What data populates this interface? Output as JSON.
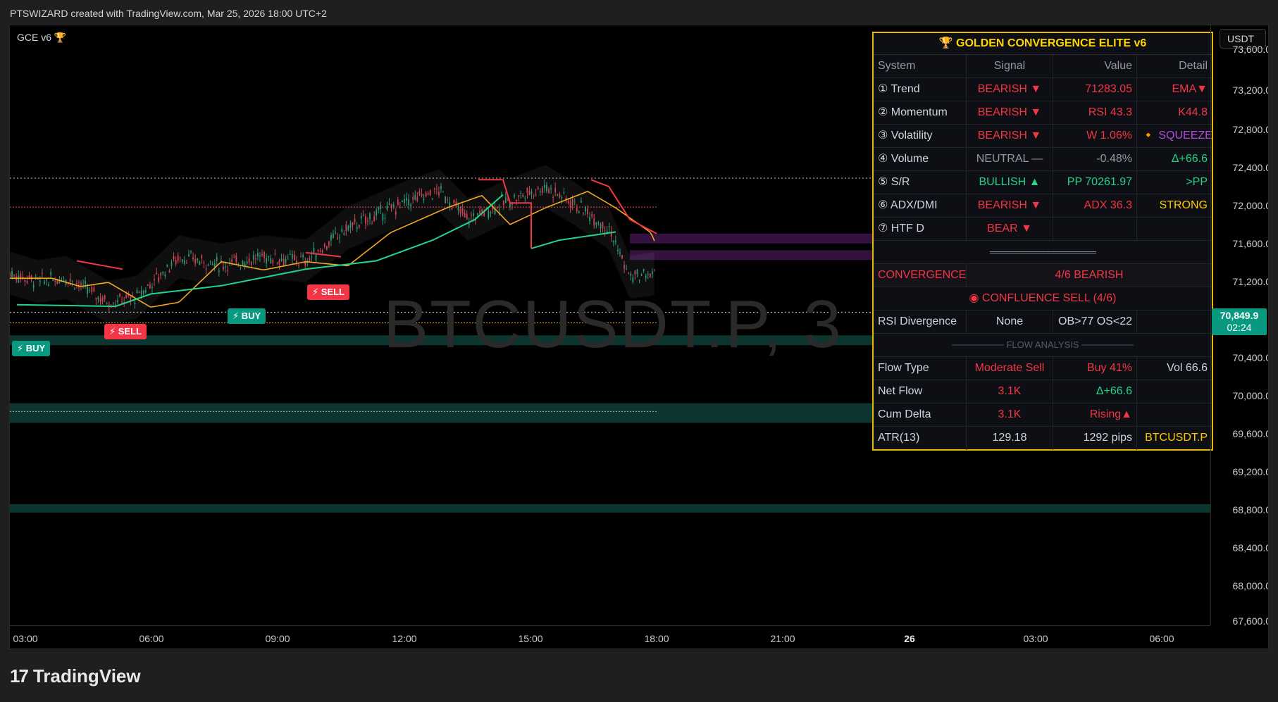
{
  "header": {
    "attribution": "PTSWIZARD created with TradingView.com, Mar 25, 2026 18:00 UTC+2"
  },
  "chart": {
    "indicator_label": "GCE v6 🏆",
    "watermark": "BTCUSDT.P, 3",
    "currency": "USDT",
    "last_price": "70,849.9",
    "countdown": "02:24",
    "price_ticks": [
      "73,600.0",
      "73,200.0",
      "72,800.0",
      "72,400.0",
      "72,000.0",
      "71,600.0",
      "71,200.0",
      "70,400.0",
      "70,000.0",
      "69,600.0",
      "69,200.0",
      "68,800.0",
      "68,400.0",
      "68,000.0",
      "67,600.0"
    ],
    "time_ticks": [
      "03:00",
      "06:00",
      "09:00",
      "12:00",
      "15:00",
      "18:00",
      "21:00",
      "26",
      "03:00",
      "06:00"
    ],
    "signals": [
      {
        "type": "buy",
        "label": "⚡ BUY"
      },
      {
        "type": "sell",
        "label": "⚡ SELL"
      },
      {
        "type": "buy",
        "label": "⚡ BUY"
      },
      {
        "type": "sell",
        "label": "⚡ SELL"
      }
    ],
    "colors": {
      "bull": "#22d38a",
      "bear": "#f23645",
      "ema": "#f5a623",
      "band": "#3a3a3a",
      "zone_teal": "#0d3b35",
      "zone_purple": "#3b1346"
    }
  },
  "panel": {
    "title": "🏆  GOLDEN CONVERGENCE ELITE v6",
    "headers": [
      "System",
      "Signal",
      "Value",
      "Detail"
    ],
    "rows": [
      [
        "① Trend",
        "BEARISH ▼",
        "71283.05",
        "EMA▼"
      ],
      [
        "② Momentum",
        "BEARISH ▼",
        "RSI 43.3",
        "K44.8"
      ],
      [
        "③ Volatility",
        "BEARISH ▼",
        "W 1.06%",
        "🔸 SQUEEZE"
      ],
      [
        "④ Volume",
        "NEUTRAL —",
        "-0.48%",
        "Δ+66.6"
      ],
      [
        "⑤ S/R",
        "BULLISH ▲",
        "PP 70261.97",
        ">PP"
      ],
      [
        "⑥ ADX/DMI",
        "BEARISH ▼",
        "ADX 36.3",
        "STRONG"
      ],
      [
        "⑦ HTF D",
        "BEAR ▼",
        "",
        ""
      ]
    ],
    "separator": "════════════════════",
    "convergence_label": "CONVERGENCE",
    "convergence_value": "4/6 BEARISH",
    "confluence": "◉ CONFLUENCE SELL (4/6)",
    "rsi_div": [
      "RSI Divergence",
      "None",
      "OB>77 OS<22",
      ""
    ],
    "flow_header": "──────── FLOW ANALYSIS ────────",
    "flow_rows": [
      [
        "Flow Type",
        "Moderate Sell",
        "Buy 41%",
        "Vol 66.6"
      ],
      [
        "Net Flow",
        "3.1K",
        "Δ+66.6",
        ""
      ],
      [
        "Cum Delta",
        "3.1K",
        "Rising▲",
        ""
      ],
      [
        "ATR(13)",
        "129.18",
        "1292 pips",
        "BTCUSDT.P"
      ]
    ]
  },
  "footer": {
    "brand": "TradingView",
    "logo_mark": "17"
  }
}
